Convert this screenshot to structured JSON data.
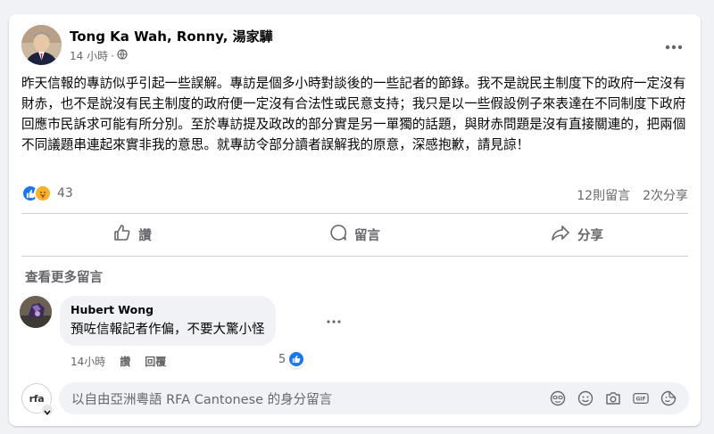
{
  "post": {
    "author": "Tong Ka Wah, Ronny, 湯家驊",
    "time": "14 小時",
    "audience_icon": "globe-icon",
    "body": "昨天信報的專訪似乎引起一些誤解。專訪是個多小時對談後的一些記者的節錄。我不是說民主制度下的政府一定沒有財赤，也不是說沒有民主制度的政府便一定沒有合法性或民意支持；我只是以一些假設例子來表達在不同制度下政府回應市民訴求可能有所分別。至於專訪提及政改的部分實是另一單獨的話題，與財赤問題是沒有直接關連的，把兩個不同議題串連起來實非我的意思。就專訪令部分讀者誤解我的原意，深感抱歉，請見諒！",
    "reaction_count": "43",
    "reactions": [
      "like-icon",
      "care-icon"
    ],
    "comment_count": "12則留言",
    "share_count": "2次分享"
  },
  "actions": {
    "like": "讚",
    "comment": "留言",
    "share": "分享"
  },
  "comments": {
    "view_more": "查看更多留言",
    "items": [
      {
        "author": "Hubert Wong",
        "text": "預咗信報記者作偏，不要大驚小怪",
        "time": "14小時",
        "like": "讚",
        "reply": "回覆",
        "reaction_count": "5"
      }
    ]
  },
  "composer": {
    "placeholder": "以自由亞洲粵語 RFA Cantonese 的身分留言",
    "avatar_text": "rfa",
    "icons": [
      "avatar-sticker-icon",
      "emoji-icon",
      "camera-icon",
      "gif-icon",
      "sticker-icon"
    ]
  },
  "colors": {
    "accent": "#1877f2",
    "secondary_text": "#65676b",
    "background": "#f0f2f5"
  }
}
